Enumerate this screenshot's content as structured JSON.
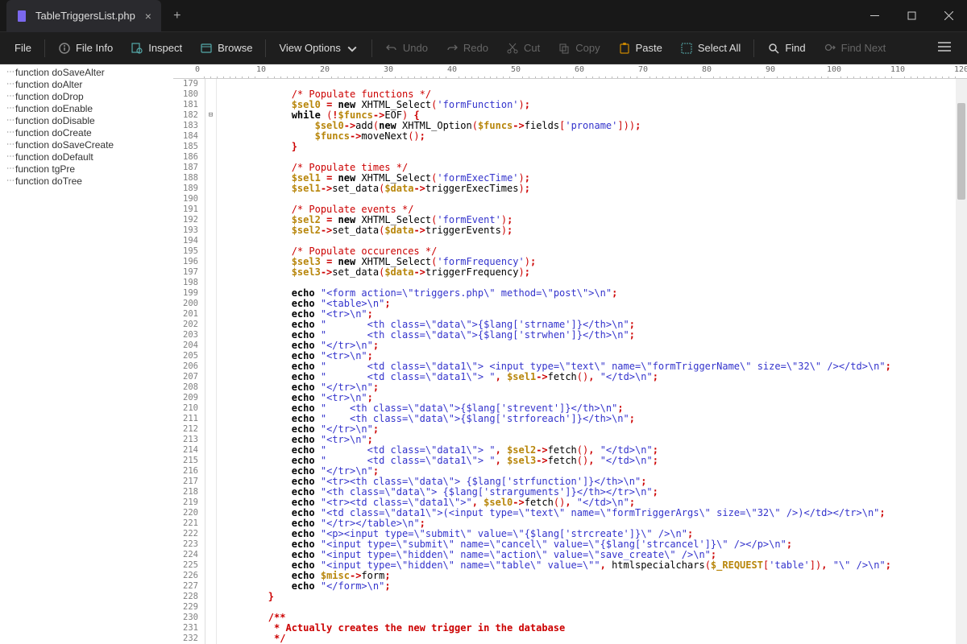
{
  "tab": {
    "title": "TableTriggersList.php"
  },
  "toolbar": {
    "file": "File",
    "fileinfo": "File Info",
    "inspect": "Inspect",
    "browse": "Browse",
    "viewopts": "View Options",
    "undo": "Undo",
    "redo": "Redo",
    "cut": "Cut",
    "copy": "Copy",
    "paste": "Paste",
    "selectall": "Select All",
    "find": "Find",
    "findnext": "Find Next"
  },
  "sidebar": {
    "items": [
      "function doSaveAlter",
      "function doAlter",
      "function doDrop",
      "function doEnable",
      "function doDisable",
      "function doCreate",
      "function doSaveCreate",
      "function doDefault",
      "function tgPre",
      "function doTree"
    ]
  },
  "ruler": {
    "start": 0,
    "step": 10,
    "count": 12,
    "charWidth": 7.9,
    "offset": 30
  },
  "code": {
    "first_line": 179,
    "lines": [
      {
        "t": "blank"
      },
      {
        "t": "comment",
        "indent": 3,
        "text": "/* Populate functions */"
      },
      {
        "t": "assign_new",
        "indent": 3,
        "var": "$sel0",
        "cls": "XHTML_Select",
        "arg": "'formFunction'"
      },
      {
        "t": "while",
        "indent": 3,
        "cond": [
          "!",
          "$funcs",
          "->EOF"
        ]
      },
      {
        "t": "call_add",
        "indent": 4,
        "obj": "$sel0",
        "inner_var": "$funcs",
        "field": "'proname'"
      },
      {
        "t": "call_mn",
        "indent": 4,
        "obj": "$funcs"
      },
      {
        "t": "close",
        "indent": 3
      },
      {
        "t": "blank"
      },
      {
        "t": "comment",
        "indent": 3,
        "text": "/* Populate times */"
      },
      {
        "t": "assign_new",
        "indent": 3,
        "var": "$sel1",
        "cls": "XHTML_Select",
        "arg": "'formExecTime'"
      },
      {
        "t": "setdata",
        "indent": 3,
        "obj": "$sel1",
        "dat": "$data",
        "prop": "triggerExecTimes"
      },
      {
        "t": "blank"
      },
      {
        "t": "comment",
        "indent": 3,
        "text": "/* Populate events */"
      },
      {
        "t": "assign_new",
        "indent": 3,
        "var": "$sel2",
        "cls": "XHTML_Select",
        "arg": "'formEvent'"
      },
      {
        "t": "setdata",
        "indent": 3,
        "obj": "$sel2",
        "dat": "$data",
        "prop": "triggerEvents"
      },
      {
        "t": "blank"
      },
      {
        "t": "comment",
        "indent": 3,
        "text": "/* Populate occurences */"
      },
      {
        "t": "assign_new",
        "indent": 3,
        "var": "$sel3",
        "cls": "XHTML_Select",
        "arg": "'formFrequency'"
      },
      {
        "t": "setdata",
        "indent": 3,
        "obj": "$sel3",
        "dat": "$data",
        "prop": "triggerFrequency"
      },
      {
        "t": "blank"
      },
      {
        "t": "echo",
        "indent": 3,
        "s": "\"<form action=\\\"triggers.php\\\" method=\\\"post\\\">\\n\""
      },
      {
        "t": "echo",
        "indent": 3,
        "s": "\"<table>\\n\""
      },
      {
        "t": "echo",
        "indent": 3,
        "s": "\"<tr>\\n\""
      },
      {
        "t": "echo",
        "indent": 3,
        "s": "\"       <th class=\\\"data\\\">{$lang['strname']}</th>\\n\""
      },
      {
        "t": "echo",
        "indent": 3,
        "s": "\"       <th class=\\\"data\\\">{$lang['strwhen']}</th>\\n\""
      },
      {
        "t": "echo",
        "indent": 3,
        "s": "\"</tr>\\n\""
      },
      {
        "t": "echo",
        "indent": 3,
        "s": "\"<tr>\\n\""
      },
      {
        "t": "echo",
        "indent": 3,
        "s": "\"       <td class=\\\"data1\\\"> <input type=\\\"text\\\" name=\\\"formTriggerName\\\" size=\\\"32\\\" /></td>\\n\""
      },
      {
        "t": "echo_fetch",
        "indent": 3,
        "pre": "\"       <td class=\\\"data1\\\"> \"",
        "obj": "$sel1",
        "post": "\"</td>\\n\""
      },
      {
        "t": "echo",
        "indent": 3,
        "s": "\"</tr>\\n\""
      },
      {
        "t": "echo",
        "indent": 3,
        "s": "\"<tr>\\n\""
      },
      {
        "t": "echo",
        "indent": 3,
        "s": "\"    <th class=\\\"data\\\">{$lang['strevent']}</th>\\n\""
      },
      {
        "t": "echo",
        "indent": 3,
        "s": "\"    <th class=\\\"data\\\">{$lang['strforeach']}</th>\\n\""
      },
      {
        "t": "echo",
        "indent": 3,
        "s": "\"</tr>\\n\""
      },
      {
        "t": "echo",
        "indent": 3,
        "s": "\"<tr>\\n\""
      },
      {
        "t": "echo_fetch",
        "indent": 3,
        "pre": "\"       <td class=\\\"data1\\\"> \"",
        "obj": "$sel2",
        "post": "\"</td>\\n\""
      },
      {
        "t": "echo_fetch",
        "indent": 3,
        "pre": "\"       <td class=\\\"data1\\\"> \"",
        "obj": "$sel3",
        "post": "\"</td>\\n\""
      },
      {
        "t": "echo",
        "indent": 3,
        "s": "\"</tr>\\n\""
      },
      {
        "t": "echo",
        "indent": 3,
        "s": "\"<tr><th class=\\\"data\\\"> {$lang['strfunction']}</th>\\n\""
      },
      {
        "t": "echo",
        "indent": 3,
        "s": "\"<th class=\\\"data\\\"> {$lang['strarguments']}</th></tr>\\n\""
      },
      {
        "t": "echo_fetch",
        "indent": 3,
        "pre": "\"<tr><td class=\\\"data1\\\">\"",
        "obj": "$sel0",
        "post": "\"</td>\\n\""
      },
      {
        "t": "echo",
        "indent": 3,
        "s": "\"<td class=\\\"data1\\\">(<input type=\\\"text\\\" name=\\\"formTriggerArgs\\\" size=\\\"32\\\" />)</td></tr>\\n\""
      },
      {
        "t": "echo",
        "indent": 3,
        "s": "\"</tr></table>\\n\""
      },
      {
        "t": "echo",
        "indent": 3,
        "s": "\"<p><input type=\\\"submit\\\" value=\\\"{$lang['strcreate']}\\\" />\\n\""
      },
      {
        "t": "echo",
        "indent": 3,
        "s": "\"<input type=\\\"submit\\\" name=\\\"cancel\\\" value=\\\"{$lang['strcancel']}\\\" /></p>\\n\""
      },
      {
        "t": "echo",
        "indent": 3,
        "s": "\"<input type=\\\"hidden\\\" name=\\\"action\\\" value=\\\"save_create\\\" />\\n\""
      },
      {
        "t": "echo_hsc",
        "indent": 3,
        "pre": "\"<input type=\\\"hidden\\\" name=\\\"table\\\" value=\\\"\"",
        "sv": "$_REQUEST",
        "key": "'table'",
        "post": "\"\\\" />\\n\""
      },
      {
        "t": "echo_form",
        "indent": 3,
        "obj": "$misc"
      },
      {
        "t": "echo",
        "indent": 3,
        "s": "\"</form>\\n\""
      },
      {
        "t": "close",
        "indent": 2
      },
      {
        "t": "blank"
      },
      {
        "t": "doccomment",
        "indent": 2,
        "text": "/**"
      },
      {
        "t": "doccomment",
        "indent": 2,
        "text": " * Actually creates the new trigger in the database"
      },
      {
        "t": "doccomment",
        "indent": 2,
        "text": " */"
      }
    ]
  }
}
